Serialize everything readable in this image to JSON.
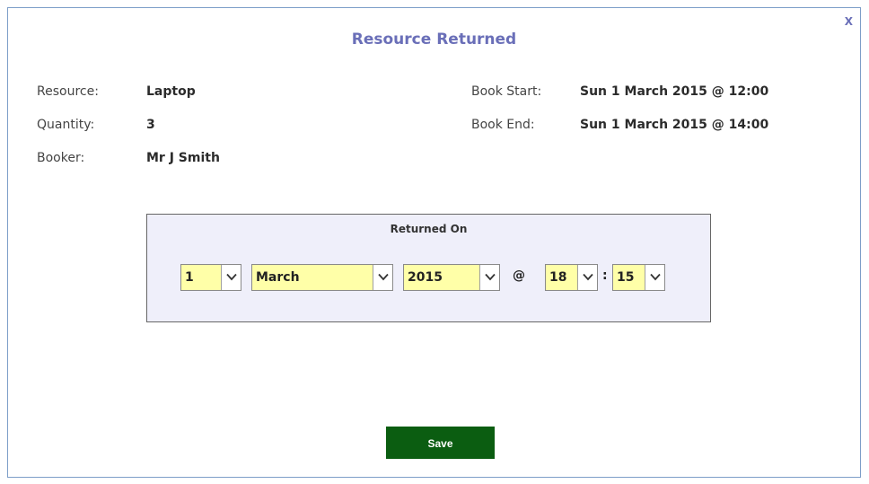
{
  "dialog": {
    "title": "Resource Returned",
    "close_label": "X"
  },
  "details": {
    "resource_label": "Resource:",
    "resource_value": "Laptop",
    "quantity_label": "Quantity:",
    "quantity_value": "3",
    "booker_label": "Booker:",
    "booker_value": "Mr J Smith",
    "book_start_label": "Book Start:",
    "book_start_value": "Sun 1 March 2015 @ 12:00",
    "book_end_label": "Book End:",
    "book_end_value": "Sun 1 March 2015 @ 14:00"
  },
  "returned_on": {
    "title": "Returned On",
    "day": "1",
    "month": "March",
    "year": "2015",
    "at_symbol": "@",
    "hour": "18",
    "time_separator": ":",
    "minute": "15"
  },
  "actions": {
    "save_label": "Save"
  },
  "colors": {
    "title": "#6a6fb8",
    "select_bg": "#ffffa8",
    "panel_bg": "#efeffa",
    "save_bg": "#0b5d11",
    "border": "#7d9ec8"
  }
}
